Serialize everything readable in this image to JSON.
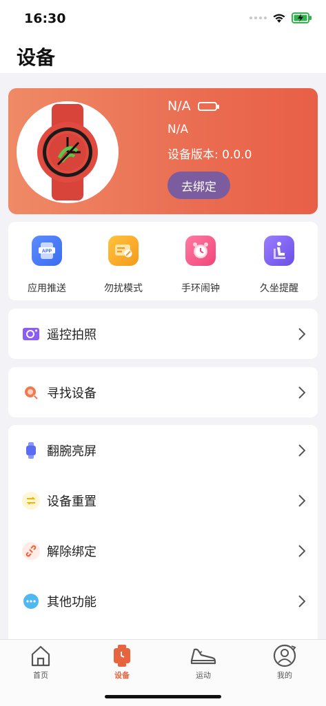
{
  "status_bar": {
    "time": "16:30"
  },
  "header": {
    "title": "设备"
  },
  "device_card": {
    "name": "N/A",
    "line2": "N/A",
    "version_label": "设备版本: 0.0.0",
    "unbind_label": "去绑定"
  },
  "quick_actions": [
    {
      "label": "应用推送",
      "icon": "app-push-icon"
    },
    {
      "label": "勿扰模式",
      "icon": "do-not-disturb-icon"
    },
    {
      "label": "手环闹钟",
      "icon": "alarm-clock-icon"
    },
    {
      "label": "久坐提醒",
      "icon": "sedentary-reminder-icon"
    }
  ],
  "menu": {
    "remote_photo": "遥控拍照",
    "find_device": "寻找设备",
    "wrist_bright": "翻腕亮屏",
    "device_reset": "设备重置",
    "unbind": "解除绑定",
    "other": "其他功能"
  },
  "tabs": [
    {
      "label": "首页"
    },
    {
      "label": "设备"
    },
    {
      "label": "运动"
    },
    {
      "label": "我的"
    }
  ],
  "colors": {
    "accent": "#e8643f",
    "card_start": "#ef8a66",
    "card_end": "#e85f47",
    "unbind_button": "#7b5c9e"
  }
}
